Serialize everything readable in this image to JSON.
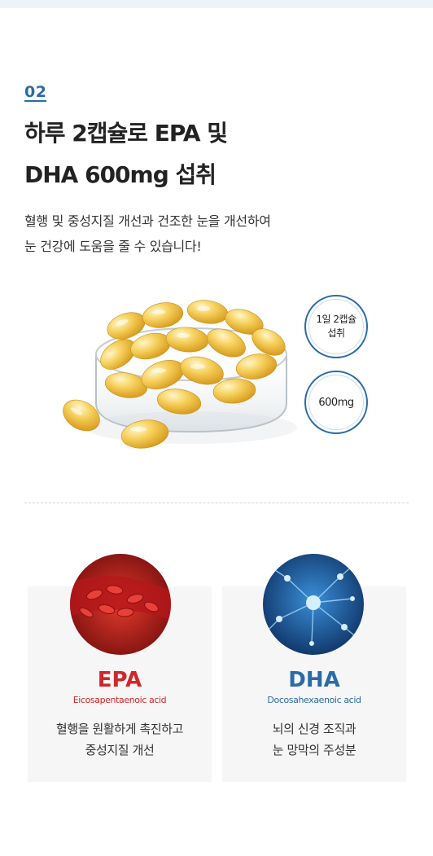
{
  "section": {
    "number": "02",
    "headline_line1": "하루 2캡슐로 EPA 및",
    "headline_line2": "DHA 600mg 섭취",
    "description_line1": "혈행 및 중성지질 개선과 건조한 눈을 개선하여",
    "description_line2": "눈 건강에 도움을 줄 수 있습니다!"
  },
  "badges": {
    "dose_line1": "1일 2캡슐",
    "dose_line2": "섭취",
    "amount": "600mg"
  },
  "cards": {
    "epa": {
      "title": "EPA",
      "subtitle": "Eicosapentaenoic acid",
      "text_line1": "혈행을 원활하게 촉진하고",
      "text_line2": "중성지질 개선",
      "accent": "#d0272a"
    },
    "dha": {
      "title": "DHA",
      "subtitle": "Docosahexaenoic acid",
      "text_line1": "뇌의 신경 조직과",
      "text_line2": "눈 망막의 주성분",
      "accent": "#2a6ba8"
    }
  },
  "colors": {
    "brand_blue": "#2a6ba8",
    "highlight": "#dbe8f4",
    "capsule_gold": "#f0c44a"
  }
}
